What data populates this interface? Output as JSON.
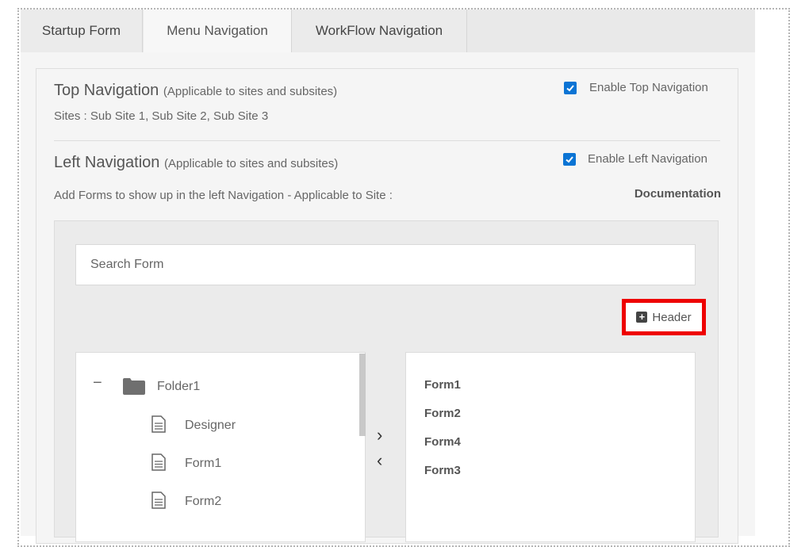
{
  "tabs": [
    {
      "label": "Startup Form"
    },
    {
      "label": "Menu Navigation"
    },
    {
      "label": "WorkFlow Navigation"
    }
  ],
  "top_navigation": {
    "title": "Top Navigation",
    "subtitle": "(Applicable to sites and subsites)",
    "sites_text": "Sites : Sub Site 1, Sub Site 2, Sub Site 3",
    "checkbox_label": "Enable Top Navigation",
    "checked": true
  },
  "left_navigation": {
    "title": "Left Navigation",
    "subtitle": "(Applicable to sites and subsites)",
    "description": "Add Forms to show up in the left Navigation - Applicable to Site :",
    "site_name": "Documentation",
    "checkbox_label": "Enable Left Navigation",
    "checked": true
  },
  "search": {
    "placeholder": "Search Form"
  },
  "header_button": {
    "label": "Header"
  },
  "tree": {
    "collapse_symbol": "−",
    "folder": {
      "label": "Folder1"
    },
    "children": [
      {
        "label": "Designer"
      },
      {
        "label": "Form1"
      },
      {
        "label": "Form2"
      }
    ]
  },
  "transfer": {
    "move_right": "›",
    "move_left": "‹"
  },
  "selected_forms": [
    {
      "label": "Form1"
    },
    {
      "label": "Form2"
    },
    {
      "label": "Form4"
    },
    {
      "label": "Form3"
    }
  ],
  "colors": {
    "checkbox": "#0b74d4",
    "highlight_border": "#ee0000"
  }
}
